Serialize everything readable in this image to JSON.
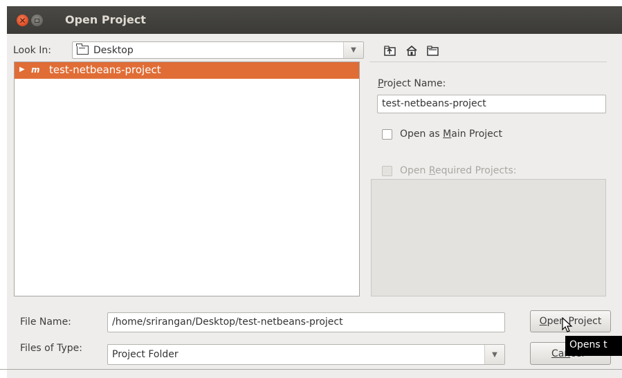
{
  "window": {
    "title": "Open Project"
  },
  "look_in": {
    "label": "Look In:",
    "value": "Desktop"
  },
  "toolbar": {
    "icons": [
      "up-folder-icon",
      "home-icon",
      "new-folder-icon"
    ]
  },
  "file_list": {
    "items": [
      {
        "badge": "m",
        "name": "test-netbeans-project",
        "selected": true
      }
    ]
  },
  "project_name": {
    "label": "Project Name:",
    "value": "test-netbeans-project"
  },
  "open_main": {
    "label_pre": "Open as ",
    "label_u": "M",
    "label_post": "ain Project",
    "checked": false
  },
  "open_required": {
    "label_pre": "Open ",
    "label_u": "R",
    "label_post": "equired Projects:",
    "checked": false,
    "enabled": false
  },
  "file_name": {
    "label": "File Name:",
    "value": "/home/srirangan/Desktop/test-netbeans-project"
  },
  "files_of_type": {
    "label": "Files of Type:",
    "value": "Project Folder"
  },
  "buttons": {
    "open_u": "O",
    "open_rest": "pen Project",
    "cancel_u": "Can",
    "cancel_rest": "cel"
  },
  "tooltip": {
    "text": "Opens t"
  },
  "colors": {
    "selection": "#e06d36",
    "titlebar": "#3c3b37",
    "close": "#e0502a"
  }
}
